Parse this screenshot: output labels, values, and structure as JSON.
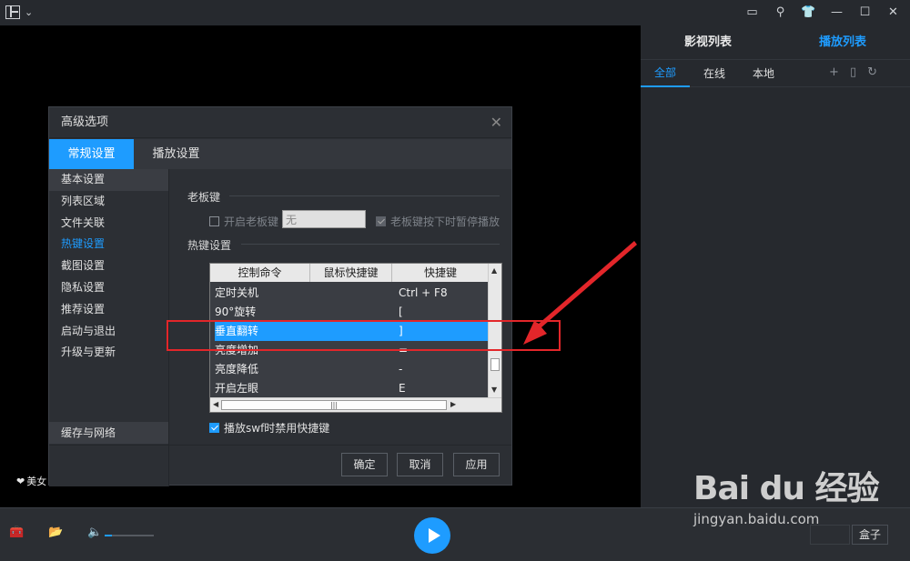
{
  "right_panel": {
    "tabs": [
      "影视列表",
      "播放列表"
    ],
    "subtabs": [
      "全部",
      "在线",
      "本地"
    ]
  },
  "video": {
    "beauty_label": "美女"
  },
  "bottom": {
    "box_label": "盒子",
    "volume_level": 0.15
  },
  "dialog": {
    "title": "高级选项",
    "tabs": [
      "常规设置",
      "播放设置"
    ],
    "sidebar": [
      "基本设置",
      "列表区域",
      "文件关联",
      "热键设置",
      "截图设置",
      "隐私设置",
      "推荐设置",
      "启动与退出",
      "升级与更新"
    ],
    "sidebar_bottom": "缓存与网络",
    "boss_key": {
      "header": "老板键",
      "enable_label": "开启老板键",
      "value": "无",
      "pause_label": "老板键按下时暂停播放"
    },
    "hotkeys": {
      "header": "热键设置",
      "columns": [
        "控制命令",
        "鼠标快捷键",
        "快捷键"
      ],
      "rows": [
        [
          "定时关机",
          "",
          "Ctrl + F8"
        ],
        [
          "90°旋转",
          "",
          "["
        ],
        [
          "垂直翻转",
          "",
          "]"
        ],
        [
          "亮度增加",
          "",
          "="
        ],
        [
          "亮度降低",
          "",
          "-"
        ],
        [
          "开启左眼",
          "",
          "E"
        ]
      ],
      "swf_label": "播放swf时禁用快捷键"
    },
    "buttons": {
      "ok": "确定",
      "cancel": "取消",
      "apply": "应用"
    }
  },
  "watermark": {
    "logo": "Bai du 经验",
    "url": "jingyan.baidu.com"
  }
}
